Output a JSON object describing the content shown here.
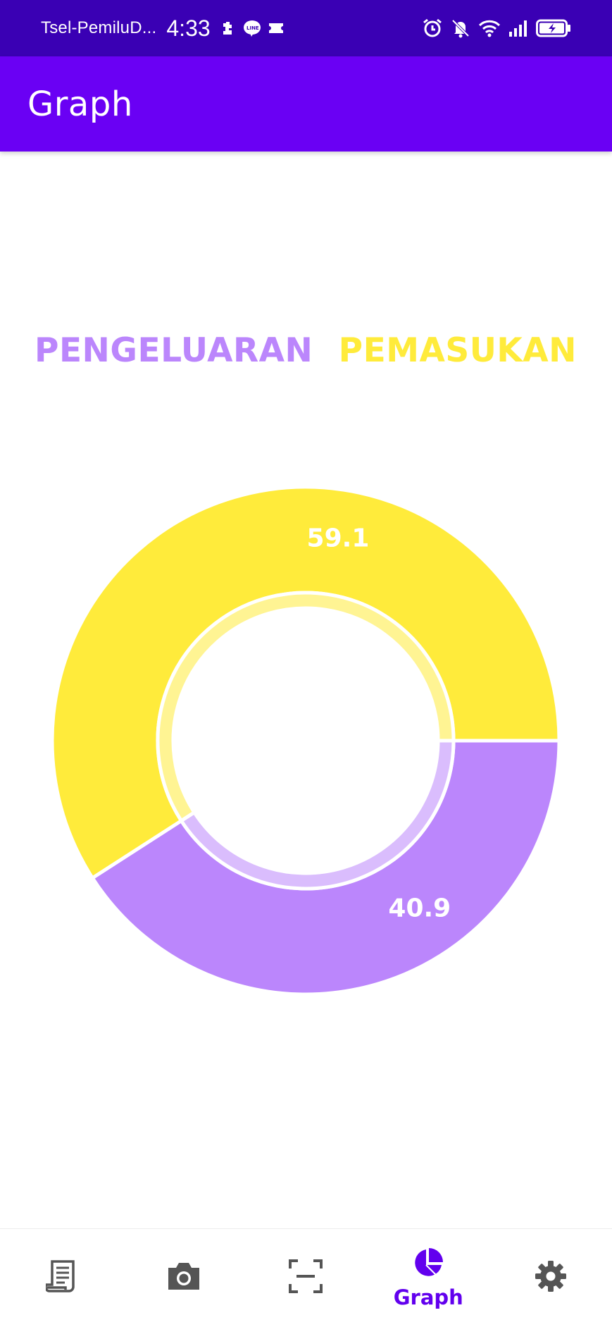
{
  "status_bar": {
    "carrier": "Tsel-PemiluD...",
    "time": "4:33",
    "icons_left": [
      "puzzle-icon",
      "line-chat-icon",
      "ticket-icon"
    ],
    "icons_right": [
      "alarm-icon",
      "mute-icon",
      "wifi-icon",
      "signal-icon",
      "battery-charging-icon"
    ]
  },
  "app_bar": {
    "title": "Graph",
    "color": "#6a00f4"
  },
  "chart_data": {
    "type": "pie",
    "variant": "donut",
    "legend_position": "top",
    "series": [
      {
        "name": "PENGELUARAN",
        "value": 40.9,
        "color": "#bb86fc",
        "label": "40.9"
      },
      {
        "name": "PEMASUKAN",
        "value": 59.1,
        "color": "#ffeb3b",
        "label": "59.1"
      }
    ]
  },
  "bottom_nav": {
    "items": [
      {
        "icon": "receipt-icon",
        "label": "",
        "active": false
      },
      {
        "icon": "camera-icon",
        "label": "",
        "active": false
      },
      {
        "icon": "scan-icon",
        "label": "",
        "active": false
      },
      {
        "icon": "pie-chart-icon",
        "label": "Graph",
        "active": true
      },
      {
        "icon": "settings-icon",
        "label": "",
        "active": false
      }
    ],
    "active_color": "#6200ee",
    "inactive_color": "#555555"
  }
}
